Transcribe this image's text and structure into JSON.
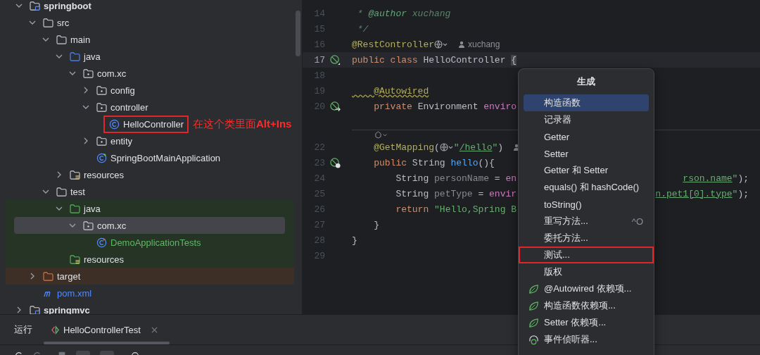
{
  "tree": [
    {
      "label": "springboot",
      "kind": "module",
      "expanded": true,
      "selected": false,
      "children": [
        {
          "label": "src",
          "kind": "folder",
          "expanded": true,
          "selected": false,
          "children": [
            {
              "label": "main",
              "kind": "folder",
              "expanded": true,
              "selected": false,
              "children": [
                {
                  "label": "java",
                  "kind": "source-folder",
                  "expanded": true,
                  "selected": false,
                  "children": [
                    {
                      "label": "com.xc",
                      "kind": "package",
                      "expanded": true,
                      "selected": false,
                      "children": [
                        {
                          "label": "config",
                          "kind": "package",
                          "expanded": false,
                          "selected": false
                        },
                        {
                          "label": "controller",
                          "kind": "package",
                          "expanded": true,
                          "selected": false,
                          "children": [
                            {
                              "label": "HelloController",
                              "kind": "class",
                              "selected": false,
                              "boxed": true,
                              "note": "在这个类里面**Alt+Ins**"
                            }
                          ]
                        },
                        {
                          "label": "entity",
                          "kind": "package",
                          "expanded": false,
                          "selected": false
                        },
                        {
                          "label": "SpringBootMainApplication",
                          "kind": "spring-class",
                          "selected": false
                        }
                      ]
                    }
                  ]
                },
                {
                  "label": "resources",
                  "kind": "resources",
                  "expanded": false,
                  "selected": false
                }
              ]
            },
            {
              "label": "test",
              "kind": "folder",
              "expanded": true,
              "selected": false,
              "children": [
                {
                  "label": "java",
                  "kind": "test-folder",
                  "expanded": true,
                  "selected": false,
                  "children": [
                    {
                      "label": "com.xc",
                      "kind": "test-package",
                      "expanded": true,
                      "selected": true,
                      "children": [
                        {
                          "label": "DemoApplicationTests",
                          "kind": "test-class",
                          "selected": false
                        }
                      ]
                    }
                  ]
                },
                {
                  "label": "resources",
                  "kind": "test-resources",
                  "selected": false
                }
              ]
            }
          ]
        },
        {
          "label": "target",
          "kind": "excluded",
          "expanded": false,
          "selected": false
        },
        {
          "label": "pom.xml",
          "kind": "maven",
          "selected": false
        }
      ]
    },
    {
      "label": "springmvc",
      "kind": "module",
      "expanded": false,
      "selected": false
    }
  ],
  "editor": {
    "lines": [
      {
        "kind": "code",
        "number": "14",
        "current": false,
        "tokens": [
          {
            "text": " * ",
            "kind": "comment"
          },
          {
            "text": "@author",
            "kind": "doctag"
          },
          {
            "text": " xuchang",
            "kind": "comment"
          }
        ]
      },
      {
        "kind": "code",
        "number": "15",
        "current": false,
        "tokens": [
          {
            "text": " */",
            "kind": "comment"
          }
        ]
      },
      {
        "kind": "code",
        "number": "16",
        "current": false,
        "tokens": [
          {
            "text": "@RestController",
            "kind": "annotation"
          },
          {
            "kind": "globe"
          },
          {
            "kind": "author",
            "text": "xuchang"
          }
        ]
      },
      {
        "kind": "code",
        "number": "17",
        "current": true,
        "gutter": {
          "kind": "bean"
        },
        "tokens": [
          {
            "text": "public class ",
            "kind": "keyword"
          },
          {
            "text": "HelloController ",
            "kind": "plain"
          },
          {
            "text": "{",
            "kind": "brace-match"
          }
        ]
      },
      {
        "kind": "code",
        "number": "18",
        "current": false
      },
      {
        "kind": "code",
        "number": "19",
        "current": false,
        "tokens": [
          {
            "text": "    @Autowired",
            "kind": "annotation-warn"
          }
        ]
      },
      {
        "kind": "code",
        "number": "20",
        "current": false,
        "gutter": {
          "kind": "bean-inject"
        },
        "tokens": [
          {
            "text": "    private ",
            "kind": "keyword"
          },
          {
            "text": "Environment ",
            "kind": "plain"
          },
          {
            "text": "enviro",
            "kind": "field"
          }
        ]
      },
      {
        "kind": "code"
      },
      {
        "kind": "inlay"
      },
      {
        "kind": "code",
        "number": "22",
        "current": false,
        "tokens": [
          {
            "text": "    @GetMapping",
            "kind": "annotation"
          },
          {
            "text": "(",
            "kind": "plain"
          },
          {
            "kind": "globe"
          },
          {
            "text": "\"",
            "kind": "string"
          },
          {
            "text": "/hello",
            "kind": "link"
          },
          {
            "text": "\"",
            "kind": "string"
          },
          {
            "text": ")",
            "kind": "plain"
          },
          {
            "kind": "author"
          }
        ]
      },
      {
        "kind": "code",
        "number": "23",
        "current": false,
        "gutter": {
          "kind": "web"
        },
        "tokens": [
          {
            "text": "    public ",
            "kind": "keyword"
          },
          {
            "text": "String ",
            "kind": "plain"
          },
          {
            "text": "hello",
            "kind": "method"
          },
          {
            "text": "(){",
            "kind": "plain"
          }
        ]
      },
      {
        "kind": "code",
        "number": "24",
        "current": false,
        "tokens": [
          {
            "text": "        String ",
            "kind": "plain"
          },
          {
            "text": "personName",
            "kind": "unused"
          },
          {
            "text": " = ",
            "kind": "plain"
          },
          {
            "text": "en",
            "kind": "field"
          }
        ],
        "tail": [
          {
            "text": "rson.name",
            "kind": "link"
          },
          {
            "text": "\"",
            "kind": "string"
          },
          {
            "text": ");",
            "kind": "plain"
          }
        ]
      },
      {
        "kind": "code",
        "number": "25",
        "current": false,
        "tokens": [
          {
            "text": "        String ",
            "kind": "plain"
          },
          {
            "text": "petType",
            "kind": "unused"
          },
          {
            "text": " = ",
            "kind": "plain"
          },
          {
            "text": "envir",
            "kind": "field"
          }
        ],
        "tail": [
          {
            "text": "n.pet1[0].type",
            "kind": "link"
          },
          {
            "text": "\"",
            "kind": "string"
          },
          {
            "text": ");",
            "kind": "plain"
          }
        ]
      },
      {
        "kind": "code",
        "number": "26",
        "current": false,
        "tokens": [
          {
            "text": "        return ",
            "kind": "keyword"
          },
          {
            "text": "\"Hello,Spring B",
            "kind": "string"
          }
        ]
      },
      {
        "kind": "code",
        "number": "27",
        "current": false,
        "tokens": [
          {
            "text": "    }",
            "kind": "plain"
          }
        ]
      },
      {
        "kind": "code",
        "number": "28",
        "current": false,
        "tokens": [
          {
            "text": "}",
            "kind": "plain"
          }
        ]
      },
      {
        "kind": "code",
        "number": "29",
        "current": false
      }
    ]
  },
  "popup": {
    "title": "生成",
    "items": [
      {
        "label": "构造函数",
        "selected": true,
        "boxed": false,
        "kind": "plain"
      },
      {
        "label": "记录器",
        "selected": false,
        "boxed": false,
        "kind": "plain"
      },
      {
        "label": "Getter",
        "selected": false,
        "boxed": false,
        "kind": "plain"
      },
      {
        "label": "Setter",
        "selected": false,
        "boxed": false,
        "kind": "plain"
      },
      {
        "label": "Getter 和 Setter",
        "selected": false,
        "boxed": false,
        "kind": "plain"
      },
      {
        "label": "equals() 和 hashCode()",
        "selected": false,
        "boxed": false,
        "kind": "plain"
      },
      {
        "label": "toString()",
        "selected": false,
        "boxed": false,
        "kind": "plain"
      },
      {
        "label": "重写方法...",
        "selected": false,
        "boxed": false,
        "kind": "plain",
        "shortcut": "^O"
      },
      {
        "label": "委托方法...",
        "selected": false,
        "boxed": false,
        "kind": "plain"
      },
      {
        "label": "测试...",
        "selected": false,
        "boxed": true,
        "kind": "plain"
      },
      {
        "label": "版权",
        "selected": false,
        "boxed": false,
        "kind": "plain"
      },
      {
        "label": "@Autowired 依赖项...",
        "selected": false,
        "boxed": false,
        "kind": "spring"
      },
      {
        "label": "构造函数依赖项...",
        "selected": false,
        "boxed": false,
        "kind": "spring"
      },
      {
        "label": "Setter 依赖项...",
        "selected": false,
        "boxed": false,
        "kind": "spring"
      },
      {
        "label": "事件侦听器...",
        "selected": false,
        "boxed": false,
        "kind": "listener"
      }
    ]
  },
  "bottom_panel": {
    "title": "运行",
    "tabs": [
      {
        "label": "HelloControllerTest",
        "selected": true
      }
    ]
  }
}
